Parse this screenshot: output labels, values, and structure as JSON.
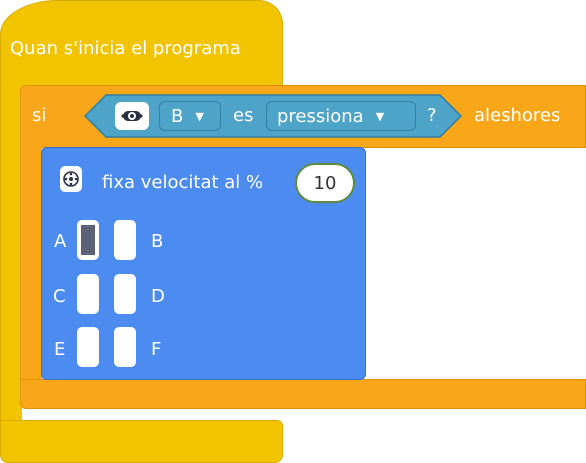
{
  "hat": {
    "label": "Quan s'inicia el programa"
  },
  "if_block": {
    "if_label": "si",
    "is_label": "es",
    "question": "?",
    "then_label": "aleshores",
    "button_dropdown": "B",
    "state_dropdown": "pressiona"
  },
  "motor_block": {
    "label": "fixa velocitat al %",
    "speed_value": "10",
    "ports": [
      {
        "left": "A",
        "right": "B",
        "left_selected": true,
        "right_selected": false
      },
      {
        "left": "C",
        "right": "D",
        "left_selected": false,
        "right_selected": false
      },
      {
        "left": "E",
        "right": "F",
        "left_selected": false,
        "right_selected": false
      }
    ]
  },
  "colors": {
    "hat": "#f2c400",
    "control": "#f9a718",
    "sensor": "#4ea3c8",
    "motor": "#4c8bf0",
    "selected_port": "#5b6178"
  },
  "icons": {
    "sensor_icon": "controller-button-icon",
    "motor_icon": "motor-pair-icon",
    "dropdown_icon": "caret-down-icon"
  }
}
